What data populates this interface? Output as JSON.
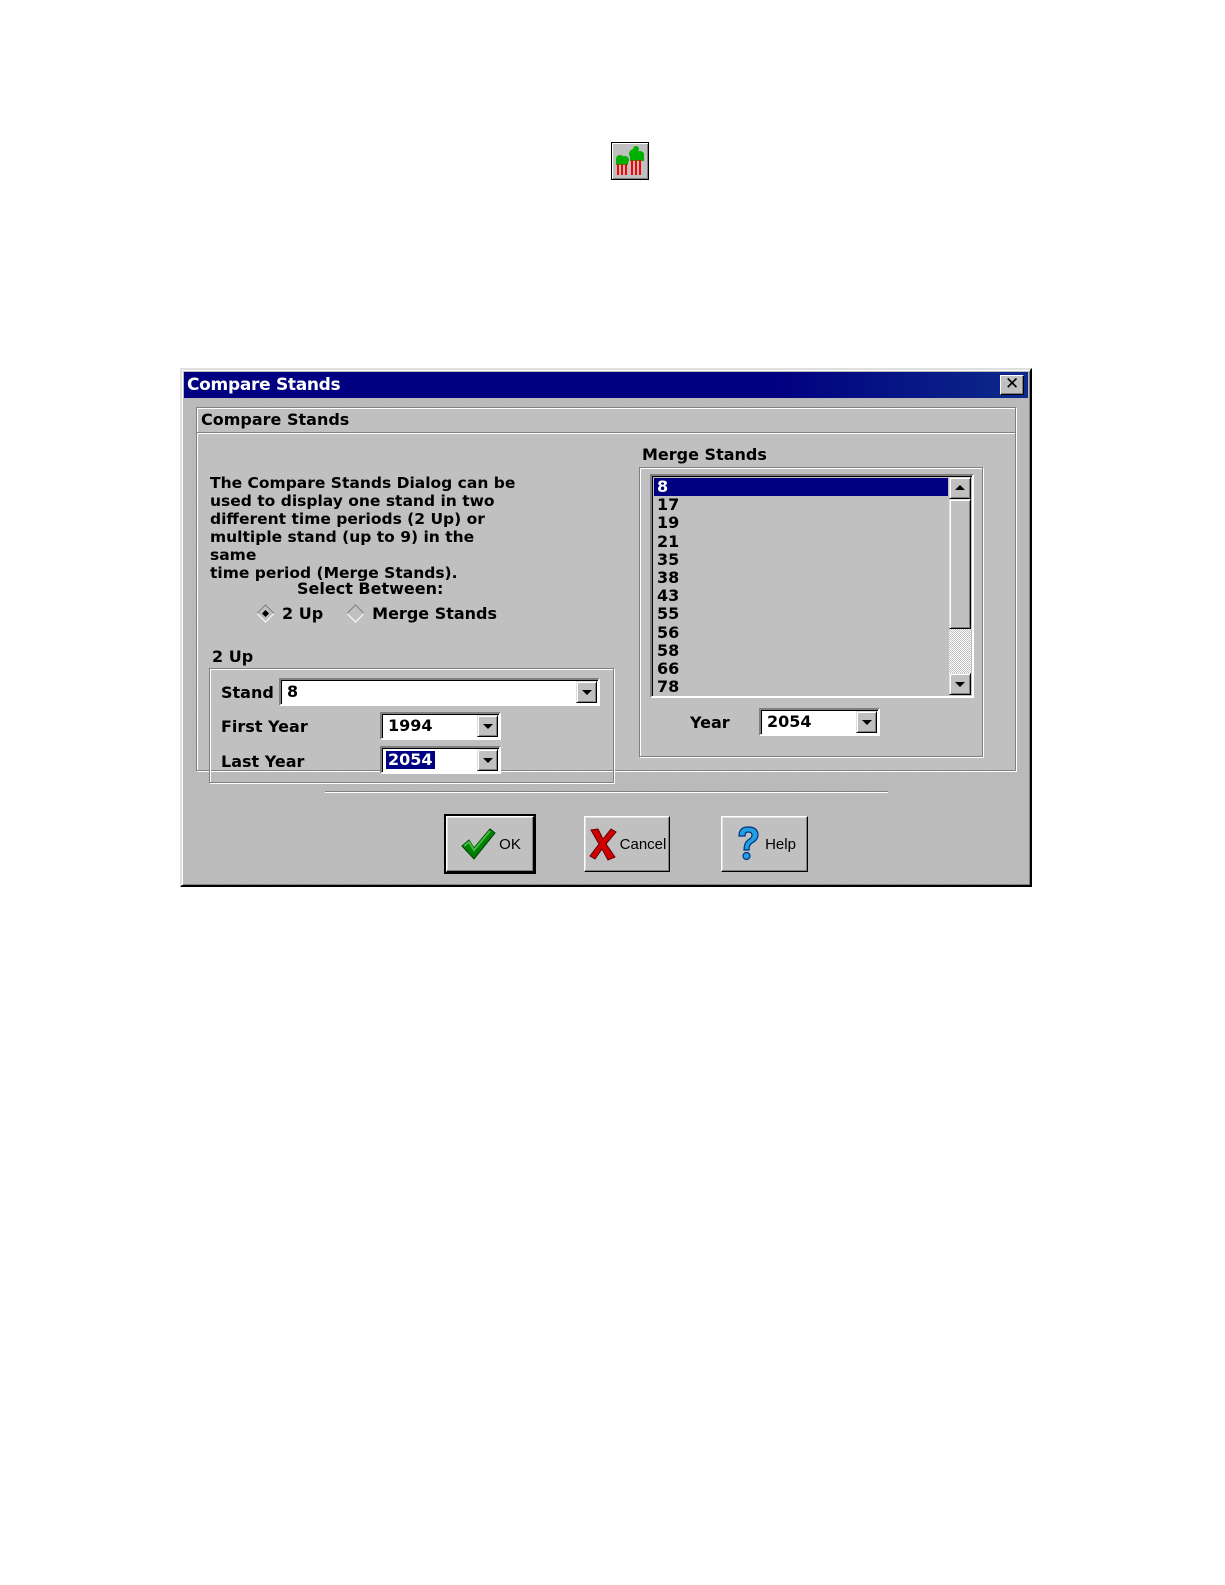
{
  "toolbar_icon": {
    "name": "compare-stands-icon",
    "colors": [
      "#00b000",
      "#ff0000",
      "#c0c0c0"
    ]
  },
  "dialog": {
    "title": "Compare Stands",
    "close_label": "✕",
    "group_title": "Compare Stands",
    "description": [
      "The Compare Stands Dialog can be",
      "used to display one stand in two",
      "different time periods (2 Up) or",
      "multiple stand (up to 9) in the same",
      "time period (Merge Stands)."
    ],
    "select_between_label": "Select Between:",
    "mode_options": [
      {
        "label": "2 Up",
        "checked": true
      },
      {
        "label": "Merge Stands",
        "checked": false
      }
    ],
    "two_up": {
      "title": "2 Up",
      "stand_label": "Stand",
      "stand_value": "8",
      "first_year_label": "First Year",
      "first_year_value": "1994",
      "last_year_label": "Last Year",
      "last_year_value": "2054"
    },
    "merge": {
      "title": "Merge Stands",
      "items": [
        "8",
        "17",
        "19",
        "21",
        "35",
        "38",
        "43",
        "55",
        "56",
        "58",
        "66",
        "78"
      ],
      "selected_item": "8",
      "year_label": "Year",
      "year_value": "2054"
    },
    "buttons": {
      "ok": "OK",
      "cancel": "Cancel",
      "help": "Help"
    }
  }
}
